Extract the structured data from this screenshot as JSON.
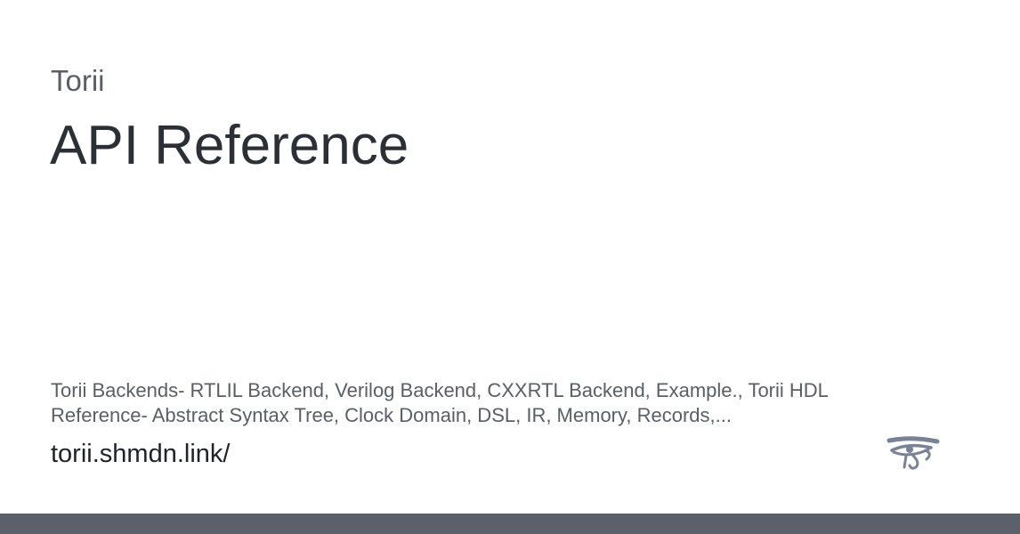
{
  "card": {
    "site_name": "Torii",
    "title": "API Reference",
    "description": "Torii Backends- RTLIL Backend, Verilog Backend, CXXRTL Backend, Example., Torii HDL Reference- Abstract Syntax Tree, Clock Domain, DSL, IR, Memory, Records,...",
    "url": "torii.shmdn.link/"
  },
  "logo": {
    "icon": "eye-of-horus-icon",
    "color": "#7a8296"
  },
  "colors": {
    "background": "#ffffff",
    "title_text": "#2b2f36",
    "secondary_text": "#5a5e66",
    "bottom_bar": "#5b606b"
  }
}
